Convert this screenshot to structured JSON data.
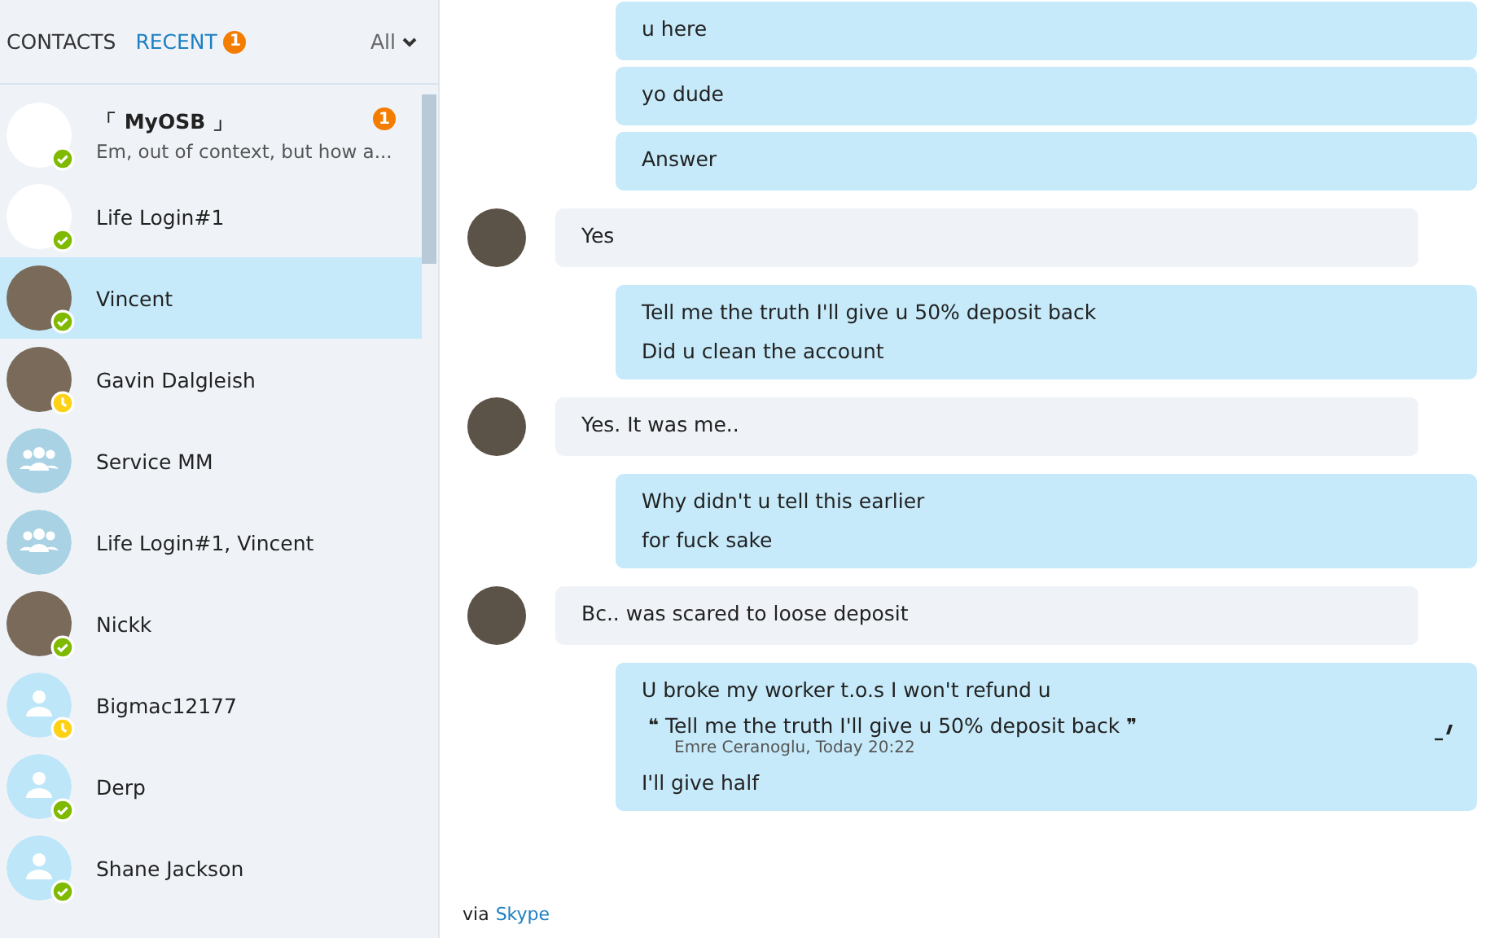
{
  "tabs": [
    {
      "label": "CONTACTS",
      "selected": false
    },
    {
      "label": "RECENT",
      "selected": true,
      "badge": "1"
    }
  ],
  "filter": {
    "label": "All"
  },
  "contacts": [
    {
      "name": "「 MyOSB 」",
      "preview": "Em, out of context, but how a...",
      "kind": "logo",
      "online": true,
      "away": false,
      "badge": "1",
      "selected": false,
      "bold": true
    },
    {
      "name": "Life Login#1",
      "kind": "logo",
      "online": true,
      "away": false,
      "selected": false,
      "bold": false
    },
    {
      "name": "Vincent",
      "kind": "photo",
      "online": true,
      "away": false,
      "selected": true,
      "bold": false
    },
    {
      "name": "Gavin Dalgleish",
      "kind": "photo",
      "online": false,
      "away": true,
      "selected": false,
      "bold": false
    },
    {
      "name": "Service MM",
      "kind": "group",
      "selected": false,
      "bold": false
    },
    {
      "name": "Life Login#1, Vincent",
      "kind": "group",
      "selected": false,
      "bold": false
    },
    {
      "name": "Nickk",
      "kind": "photo",
      "online": true,
      "away": false,
      "selected": false,
      "bold": false
    },
    {
      "name": "Bigmac12177",
      "kind": "person",
      "online": false,
      "away": true,
      "selected": false,
      "bold": false
    },
    {
      "name": "Derp",
      "kind": "person",
      "online": true,
      "away": false,
      "selected": false,
      "bold": false
    },
    {
      "name": "Shane Jackson",
      "kind": "person",
      "online": true,
      "away": false,
      "selected": false,
      "bold": false
    }
  ],
  "messages": [
    {
      "kind": "out",
      "lines": [
        "u here"
      ]
    },
    {
      "kind": "out",
      "lines": [
        "yo dude"
      ]
    },
    {
      "kind": "out",
      "lines": [
        "Answer"
      ]
    },
    {
      "kind": "in",
      "lines": [
        "Yes"
      ]
    },
    {
      "kind": "out",
      "lines": [
        "Tell me the truth I'll give u 50% deposit back",
        "Did u clean the account"
      ]
    },
    {
      "kind": "in",
      "lines": [
        "Yes. It was me.."
      ]
    },
    {
      "kind": "out",
      "lines": [
        "Why didn't u tell this earlier",
        "for fuck sake"
      ]
    },
    {
      "kind": "in",
      "lines": [
        "Bc.. was scared to loose deposit"
      ]
    },
    {
      "kind": "out",
      "lines": [
        "U broke my worker t.o.s I won't refund u"
      ],
      "quote": {
        "open": "❝",
        "text": "Tell me the truth I'll give u 50% deposit back",
        "close": "❞",
        "author": "Emre Ceranoglu, Today 20:22"
      },
      "after": [
        "I'll give half"
      ]
    }
  ],
  "footer": {
    "prefix": "via",
    "link": "Skype"
  }
}
